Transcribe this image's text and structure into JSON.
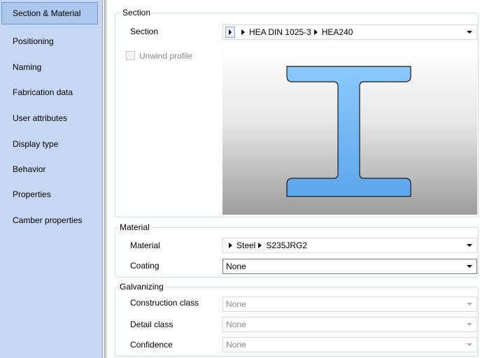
{
  "sidebar": {
    "items": [
      {
        "label": "Section & Material",
        "selected": true
      },
      {
        "label": "Positioning"
      },
      {
        "label": "Naming"
      },
      {
        "label": "Fabrication data"
      },
      {
        "label": "User attributes"
      },
      {
        "label": "Display type"
      },
      {
        "label": "Behavior"
      },
      {
        "label": "Properties"
      },
      {
        "label": "Camber properties"
      }
    ]
  },
  "section_group": {
    "title": "Section",
    "section_label": "Section",
    "section_path": [
      "HEA DIN 1025-3",
      "HEA240"
    ],
    "unwind_profile_label": "Unwind profile",
    "unwind_profile_checked": false,
    "preview_icon": "i-beam-profile-icon"
  },
  "material_group": {
    "title": "Material",
    "material_label": "Material",
    "material_path": [
      "Steel",
      "S235JRG2"
    ],
    "coating_label": "Coating",
    "coating_value": "None"
  },
  "galvanizing_group": {
    "title": "Galvanizing",
    "construction_class_label": "Construction class",
    "construction_class_value": "None",
    "detail_class_label": "Detail class",
    "detail_class_value": "None",
    "confidence_label": "Confidence",
    "confidence_value": "None"
  },
  "colors": {
    "sidebar_bg": "#c5d7f2",
    "selected_item_bg": "#adc6ec",
    "profile_fill": "#7fbff5"
  }
}
